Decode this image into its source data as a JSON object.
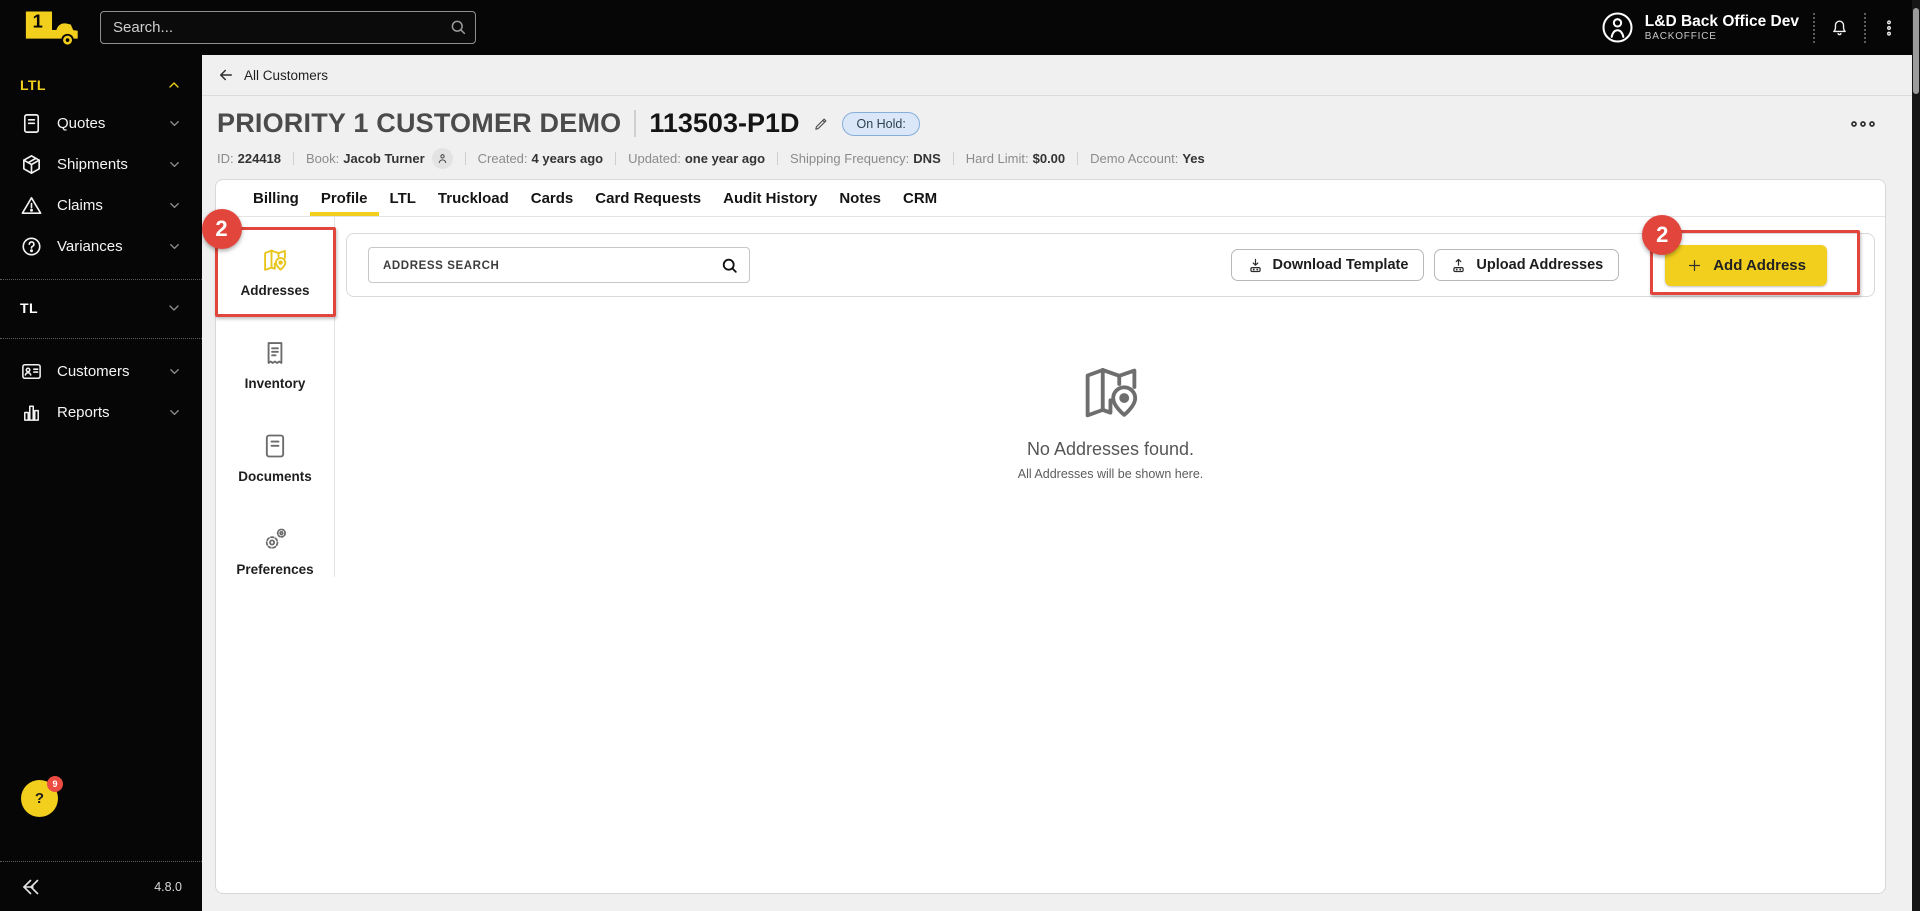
{
  "topbar": {
    "search_placeholder": "Search...",
    "user_name": "L&D Back Office Dev",
    "user_role": "BACKOFFICE"
  },
  "sidebar": {
    "group1_label": "LTL",
    "group1_items": [
      {
        "label": "Quotes",
        "icon": "document-icon"
      },
      {
        "label": "Shipments",
        "icon": "package-icon"
      },
      {
        "label": "Claims",
        "icon": "warning-triangle-icon"
      },
      {
        "label": "Variances",
        "icon": "question-circle-icon"
      }
    ],
    "group2_label": "TL",
    "group3_items": [
      {
        "label": "Customers",
        "icon": "id-badge-icon"
      },
      {
        "label": "Reports",
        "icon": "bar-chart-icon"
      }
    ],
    "help_badge": "9",
    "help_label": "?",
    "version": "4.8.0"
  },
  "page": {
    "back_label": "All Customers",
    "title": "PRIORITY 1 CUSTOMER DEMO",
    "account_number": "113503-P1D",
    "status_badge": "On Hold:",
    "meta": [
      {
        "label": "ID:",
        "value": "224418"
      },
      {
        "label": "Book:",
        "value": "Jacob Turner"
      },
      {
        "label": "Created:",
        "value": "4 years ago"
      },
      {
        "label": "Updated:",
        "value": "one year ago"
      },
      {
        "label": "Shipping Frequency:",
        "value": "DNS"
      },
      {
        "label": "Hard Limit:",
        "value": "$0.00"
      },
      {
        "label": "Demo Account:",
        "value": "Yes"
      }
    ]
  },
  "tabs": {
    "items": [
      "Billing",
      "Profile",
      "LTL",
      "Truckload",
      "Cards",
      "Card Requests",
      "Audit History",
      "Notes",
      "CRM"
    ],
    "active": "Profile"
  },
  "subnav": {
    "items": [
      {
        "label": "Addresses",
        "icon": "map-pin-icon"
      },
      {
        "label": "Inventory",
        "icon": "receipt-icon"
      },
      {
        "label": "Documents",
        "icon": "document-icon"
      },
      {
        "label": "Preferences",
        "icon": "gears-icon"
      }
    ],
    "active": "Addresses"
  },
  "content": {
    "search_placeholder": "ADDRESS SEARCH",
    "download_button": "Download Template",
    "upload_button": "Upload Addresses",
    "add_button": "Add Address",
    "empty_title": "No Addresses found.",
    "empty_subtitle": "All Addresses will be shown here."
  },
  "annotations": {
    "step_badge": "2"
  },
  "colors": {
    "accent_yellow": "#F2CE1D",
    "annotation_red": "#E2453C",
    "topbar_bg": "#060606",
    "status_badge_bg": "#D9E7F8",
    "status_badge_border": "#87AEDB"
  }
}
